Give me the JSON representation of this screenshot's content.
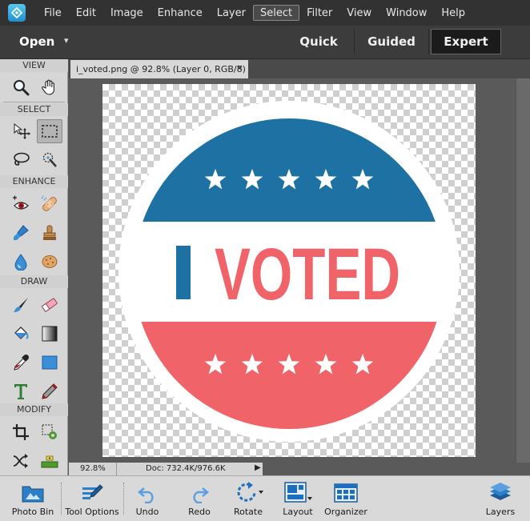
{
  "menubar": {
    "items": [
      {
        "label": "File"
      },
      {
        "label": "Edit"
      },
      {
        "label": "Image"
      },
      {
        "label": "Enhance"
      },
      {
        "label": "Layer"
      },
      {
        "label": "Select"
      },
      {
        "label": "Filter"
      },
      {
        "label": "View"
      },
      {
        "label": "Window"
      },
      {
        "label": "Help"
      }
    ],
    "active_item": "Select"
  },
  "modebar": {
    "open_label": "Open",
    "tabs": [
      {
        "label": "Quick"
      },
      {
        "label": "Guided"
      },
      {
        "label": "Expert"
      }
    ],
    "active_tab": "Expert"
  },
  "toolbox": {
    "sections": {
      "view": "VIEW",
      "select": "SELECT",
      "enhance": "ENHANCE",
      "draw": "DRAW",
      "modify": "MODIFY"
    },
    "selected_tool": "rectangular-marquee-tool"
  },
  "document": {
    "tab_title": "i_voted.png @ 92.8% (Layer 0, RGB/8)",
    "close_glyph": "×",
    "image": {
      "word_i": "I",
      "word_voted": "VOTED",
      "colors": {
        "blue": "#1d72a3",
        "red": "#f06469",
        "white": "#ffffff"
      },
      "stars_per_band": 5
    }
  },
  "statusbar": {
    "zoom": "92.8%",
    "doc_size": "Doc: 732.4K/976.6K",
    "arrow_glyph": "▶"
  },
  "bottombar": {
    "items": [
      {
        "label": "Photo Bin"
      },
      {
        "label": "Tool Options"
      },
      {
        "label": "Undo"
      },
      {
        "label": "Redo"
      },
      {
        "label": "Rotate"
      },
      {
        "label": "Layout"
      },
      {
        "label": "Organizer"
      },
      {
        "label": "Layers"
      }
    ]
  },
  "colors": {
    "menubar_bg": "#323232",
    "toolbox_bg": "#d6d6d6",
    "accent_blue": "#1a6fb0"
  }
}
